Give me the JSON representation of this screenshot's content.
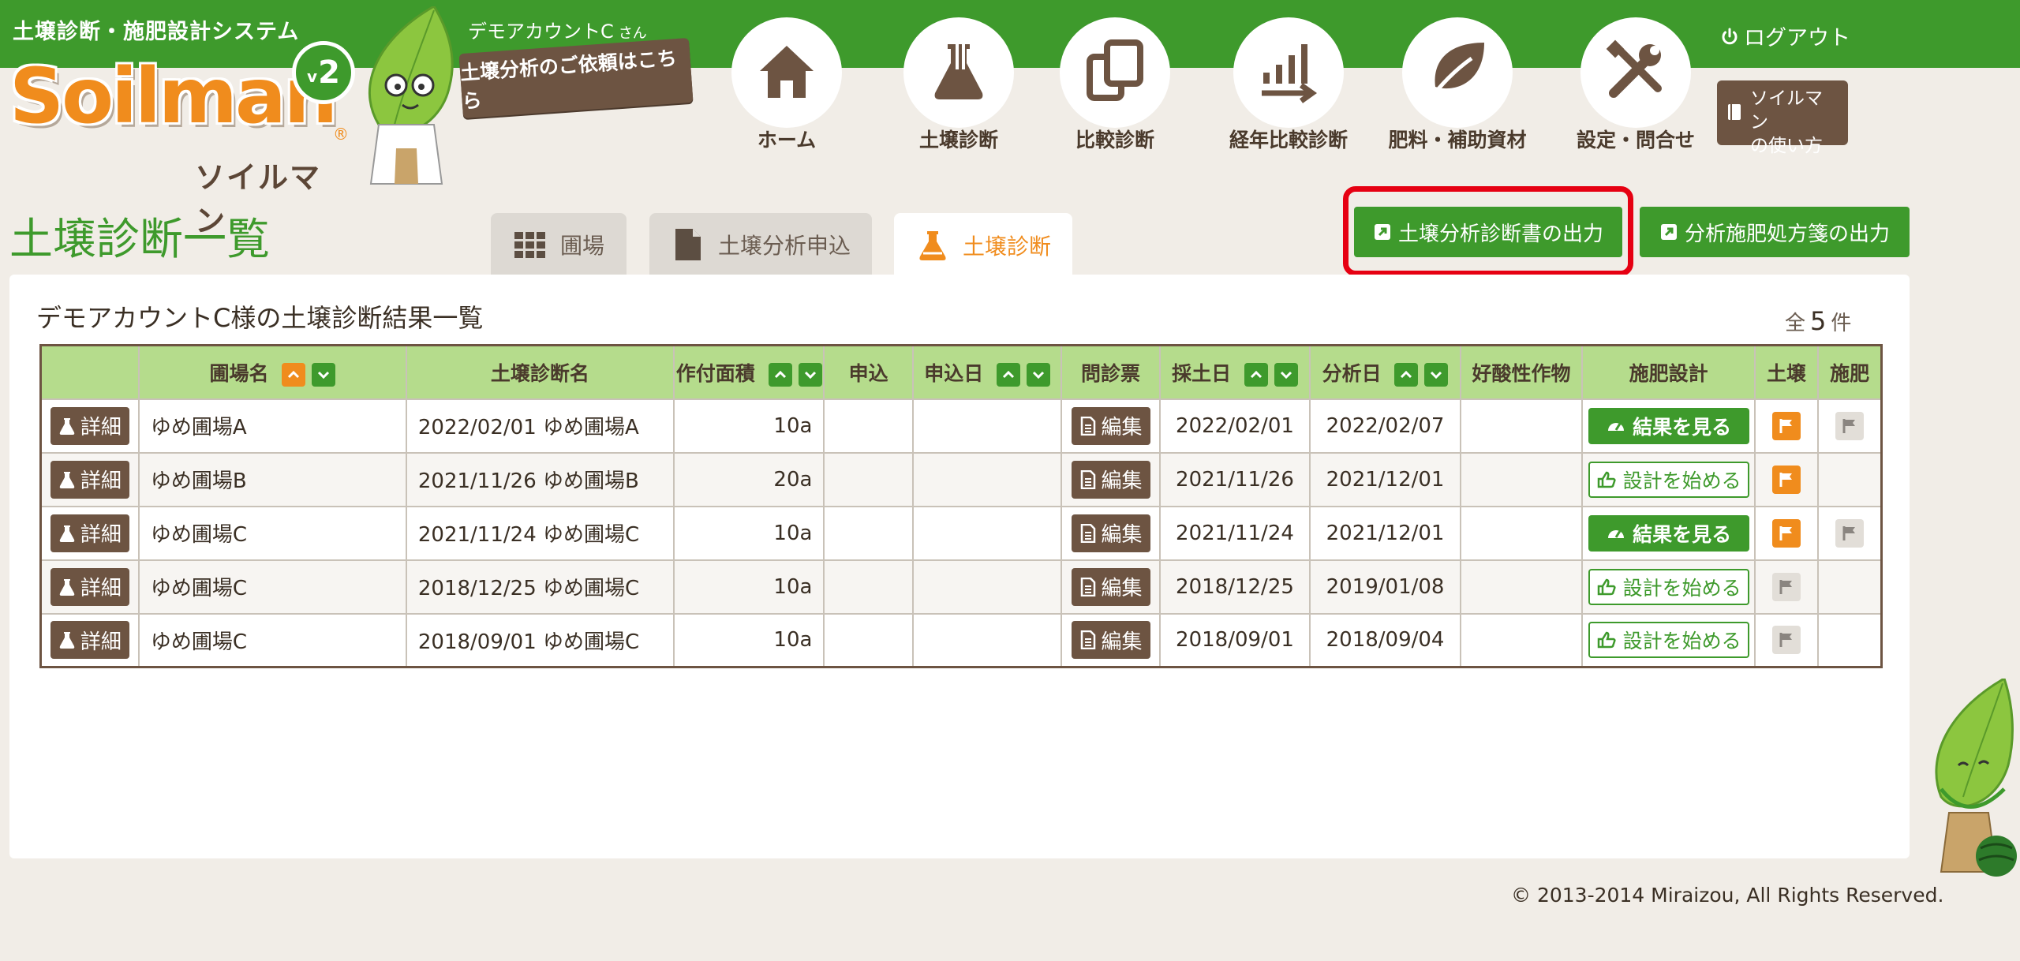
{
  "header": {
    "system_name": "土壌診断・施肥設計システム",
    "account_name": "デモアカウントC",
    "account_suffix": "さん",
    "request_link": "土壌分析のご依頼はこちら",
    "logout_label": "ログアウト",
    "logo_text": "Soilman",
    "logo_kana": "ソイルマン",
    "version": "2",
    "version_prefix": "v",
    "registered_mark": "®"
  },
  "nav": {
    "items": [
      {
        "label": "ホーム",
        "icon": "house-icon"
      },
      {
        "label": "土壌診断",
        "icon": "flask-icon"
      },
      {
        "label": "比較診断",
        "icon": "copy-icon"
      },
      {
        "label": "経年比較診断",
        "icon": "trend-chart-icon"
      },
      {
        "label": "肥料・補助資材",
        "icon": "leaf-icon"
      },
      {
        "label": "設定・問合せ",
        "icon": "tools-icon"
      }
    ],
    "howto_line1": "ソイルマン",
    "howto_line2": "の使い方"
  },
  "page": {
    "title": "土壌診断一覧",
    "tabs": [
      {
        "label": "圃場",
        "icon": "grid-icon",
        "active": false
      },
      {
        "label": "土壌分析申込",
        "icon": "document-icon",
        "active": false
      },
      {
        "label": "土壌診断",
        "icon": "flask-icon",
        "active": true
      }
    ],
    "export_report": "土壌分析診断書の出力",
    "export_prescription": "分析施肥処方箋の出力"
  },
  "panel": {
    "title": "デモアカウントC様の土壌診断結果一覧",
    "count_prefix": "全",
    "count": "5",
    "count_suffix": "件"
  },
  "table": {
    "headers": [
      "",
      "圃場名",
      "土壌診断名",
      "作付面積",
      "申込",
      "申込日",
      "問診票",
      "採土日",
      "分析日",
      "好酸性作物",
      "施肥設計",
      "土壌",
      "施肥"
    ],
    "detail_label": "詳細",
    "edit_label": "編集",
    "rows": [
      {
        "field": "ゆめ圃場A",
        "name": "2022/02/01 ゆめ圃場A",
        "area": "10a",
        "apply": "",
        "apply_date": "",
        "sample_date": "2022/02/01",
        "analysis_date": "2022/02/07",
        "acid": "",
        "design": "結果を見る",
        "design_type": "result",
        "soil_flag": "orange",
        "fert_flag": "gray"
      },
      {
        "field": "ゆめ圃場B",
        "name": "2021/11/26 ゆめ圃場B",
        "area": "20a",
        "apply": "",
        "apply_date": "",
        "sample_date": "2021/11/26",
        "analysis_date": "2021/12/01",
        "acid": "",
        "design": "設計を始める",
        "design_type": "start",
        "soil_flag": "orange",
        "fert_flag": "none"
      },
      {
        "field": "ゆめ圃場C",
        "name": "2021/11/24 ゆめ圃場C",
        "area": "10a",
        "apply": "",
        "apply_date": "",
        "sample_date": "2021/11/24",
        "analysis_date": "2021/12/01",
        "acid": "",
        "design": "結果を見る",
        "design_type": "result",
        "soil_flag": "orange",
        "fert_flag": "gray"
      },
      {
        "field": "ゆめ圃場C",
        "name": "2018/12/25 ゆめ圃場C",
        "area": "10a",
        "apply": "",
        "apply_date": "",
        "sample_date": "2018/12/25",
        "analysis_date": "2019/01/08",
        "acid": "",
        "design": "設計を始める",
        "design_type": "start",
        "soil_flag": "gray",
        "fert_flag": "none"
      },
      {
        "field": "ゆめ圃場C",
        "name": "2018/09/01 ゆめ圃場C",
        "area": "10a",
        "apply": "",
        "apply_date": "",
        "sample_date": "2018/09/01",
        "analysis_date": "2018/09/04",
        "acid": "",
        "design": "設計を始める",
        "design_type": "start",
        "soil_flag": "gray",
        "fert_flag": "none"
      }
    ]
  },
  "footer": {
    "copyright": "© 2013-2014 Miraizou, All Rights Reserved."
  },
  "colors": {
    "brand_green": "#3e9a2c",
    "brand_orange": "#f08c1d",
    "brown": "#6d5442",
    "highlight_red": "#e60012"
  }
}
